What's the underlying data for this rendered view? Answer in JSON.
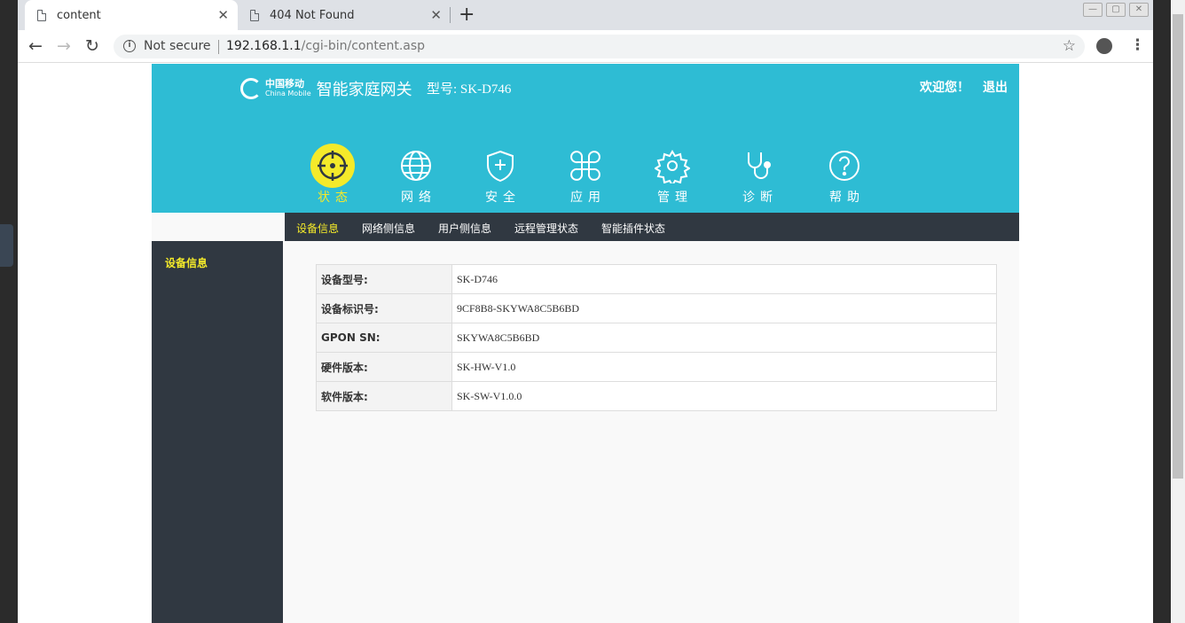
{
  "browser": {
    "tabs": [
      {
        "title": "content"
      },
      {
        "title": "404 Not Found"
      }
    ],
    "new_tab": "+",
    "tab_close": "✕",
    "security_label": "Not secure",
    "url_host": "192.168.1.1",
    "url_path": "/cgi-bin/content.asp",
    "nav": {
      "back": "←",
      "forward": "→",
      "reload": "↻",
      "star": "☆",
      "menu": "⋮"
    }
  },
  "router": {
    "brand_cn": "中国移动",
    "brand_en": "China Mobile",
    "product_name": "智能家庭网关",
    "model_label": "型号: SK-D746",
    "welcome": "欢迎您！",
    "logout": "退出",
    "main_nav": [
      {
        "label": "状态",
        "icon": "crosshair-icon",
        "active": true
      },
      {
        "label": "网络",
        "icon": "globe-icon",
        "active": false
      },
      {
        "label": "安全",
        "icon": "shield-plus-icon",
        "active": false
      },
      {
        "label": "应用",
        "icon": "command-icon",
        "active": false
      },
      {
        "label": "管理",
        "icon": "gear-icon",
        "active": false
      },
      {
        "label": "诊断",
        "icon": "stethoscope-icon",
        "active": false
      },
      {
        "label": "帮助",
        "icon": "help-icon",
        "active": false
      }
    ],
    "sub_nav": [
      "设备信息",
      "网络侧信息",
      "用户侧信息",
      "远程管理状态",
      "智能插件状态"
    ],
    "side_nav": [
      "设备信息"
    ],
    "device_info": [
      {
        "key": "设备型号:",
        "value": "SK-D746"
      },
      {
        "key": "设备标识号:",
        "value": "9CF8B8-SKYWA8C5B6BD"
      },
      {
        "key": "GPON SN:",
        "value": "SKYWA8C5B6BD"
      },
      {
        "key": "硬件版本:",
        "value": "SK-HW-V1.0"
      },
      {
        "key": "软件版本:",
        "value": "SK-SW-V1.0.0"
      }
    ]
  },
  "colors": {
    "header": "#2ebcd4",
    "dark": "#303841",
    "accent": "#f4ea2a"
  }
}
